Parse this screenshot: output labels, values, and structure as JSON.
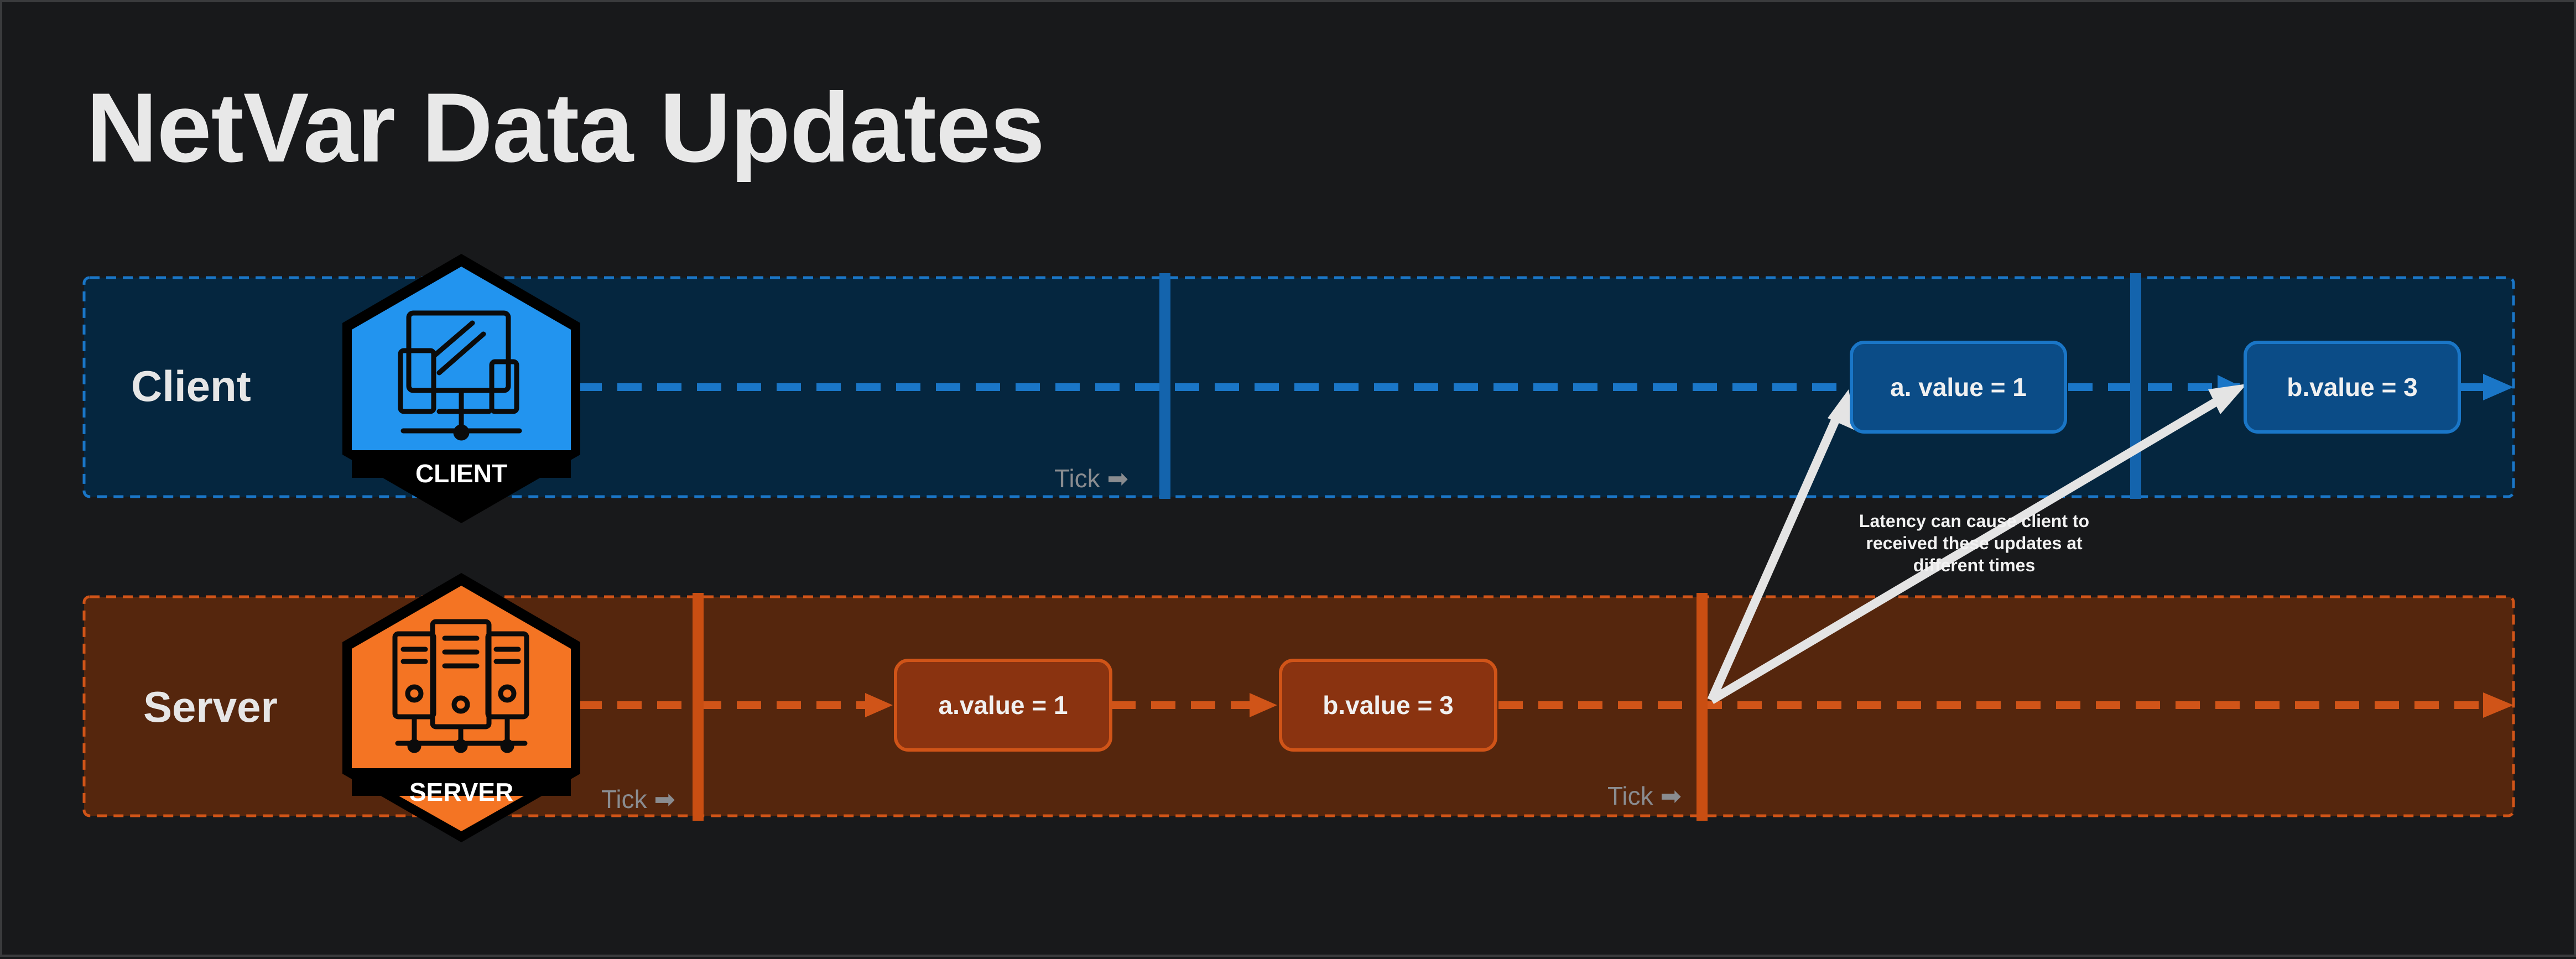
{
  "title": "NetVar Data Updates",
  "colors": {
    "background": "#18191b",
    "client_lane_bg": "#05263f",
    "client_accent": "#1a76c7",
    "server_lane_bg": "#55260d",
    "server_accent": "#d05418",
    "latency_arrow": "#e4e4e4"
  },
  "client_lane": {
    "label": "Client",
    "badge_text": "CLIENT",
    "icon": "devices-icon",
    "tick_label": "Tick ➡",
    "updates": [
      {
        "label": "a. value = 1"
      },
      {
        "label": "b.value = 3"
      }
    ]
  },
  "server_lane": {
    "label": "Server",
    "badge_text": "SERVER",
    "icon": "server-rack-icon",
    "tick_labels": [
      "Tick ➡",
      "Tick ➡"
    ],
    "updates": [
      {
        "label": "a.value = 1"
      },
      {
        "label": "b.value = 3"
      }
    ]
  },
  "latency_note": "Latency can cause client to received these updates at different times"
}
